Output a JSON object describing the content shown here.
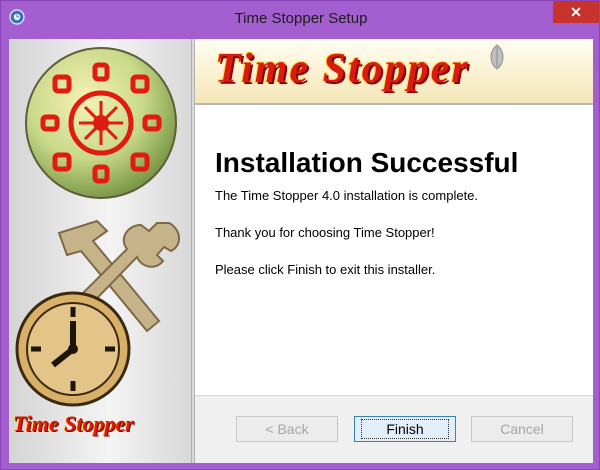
{
  "window": {
    "title": "Time Stopper Setup",
    "close_symbol": "✕"
  },
  "header": {
    "brand": "Time Stopper"
  },
  "main": {
    "heading": "Installation Successful",
    "line1": "The Time Stopper 4.0 installation is complete.",
    "line2": "Thank you for choosing Time Stopper!",
    "line3": "Please click Finish to exit this installer."
  },
  "buttons": {
    "back": "< Back",
    "finish": "Finish",
    "cancel": "Cancel"
  },
  "sidebar": {
    "brand": "Time Stopper"
  },
  "colors": {
    "frame": "#a35fd0",
    "close": "#c7332c",
    "brand_red": "#d91b12",
    "brand_gold": "#ffe05c"
  },
  "icons": [
    "app-icon",
    "close-icon",
    "mandala-emblem-icon",
    "tools-icon",
    "clock-icon",
    "leaf-icon"
  ]
}
